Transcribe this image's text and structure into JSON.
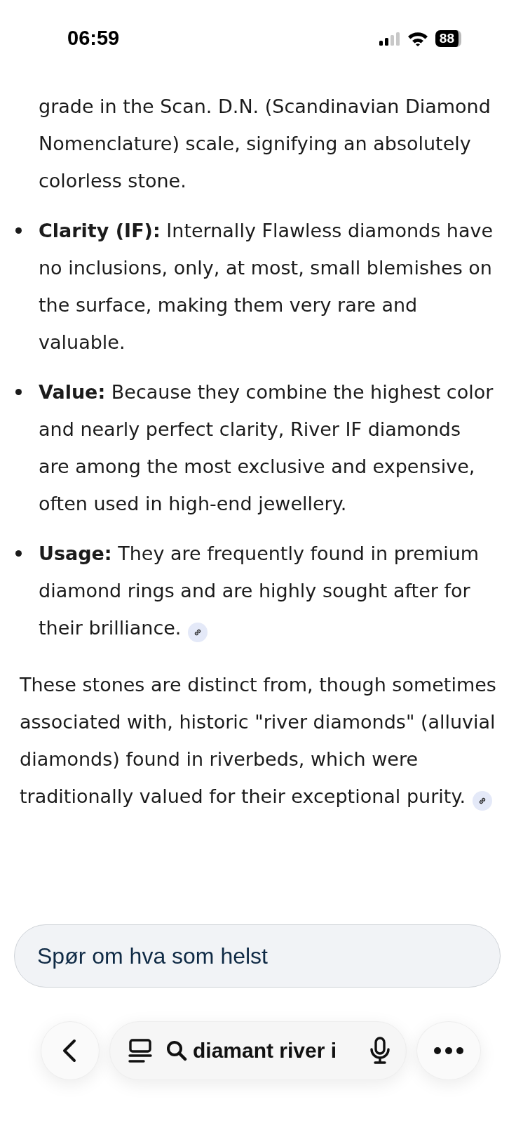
{
  "status_bar": {
    "time": "06:59",
    "battery": "88"
  },
  "bullets": [
    {
      "text": "grade in the Scan. D.N. (Scandinavian Diamond Nomenclature) scale, signifying an absolutely colorless stone.",
      "continued": true,
      "source_link": false
    },
    {
      "text": "**Clarity (IF):** Internally Flawless diamonds have no inclusions, only, at most, small blemishes on the surface, making them very rare and valuable.",
      "source_link": false
    },
    {
      "text": "**Value:** Because they combine the highest color and nearly perfect clarity, River IF diamonds are among the most exclusive and expensive, often used in high-end jewellery.",
      "source_link": false
    },
    {
      "text": "**Usage:** They are frequently found in premium diamond rings and are highly sought after for their brilliance.",
      "source_link": true
    }
  ],
  "paragraph": {
    "text": "These stones are distinct from, though sometimes associated with, historic \"river diamonds\" (alluvial diamonds) found in riverbeds, which were traditionally valued for their exceptional purity.",
    "source_link": true
  },
  "prompt_field": {
    "placeholder": "Spør om hva som helst"
  },
  "address_bar": {
    "query": "diamant river i"
  }
}
